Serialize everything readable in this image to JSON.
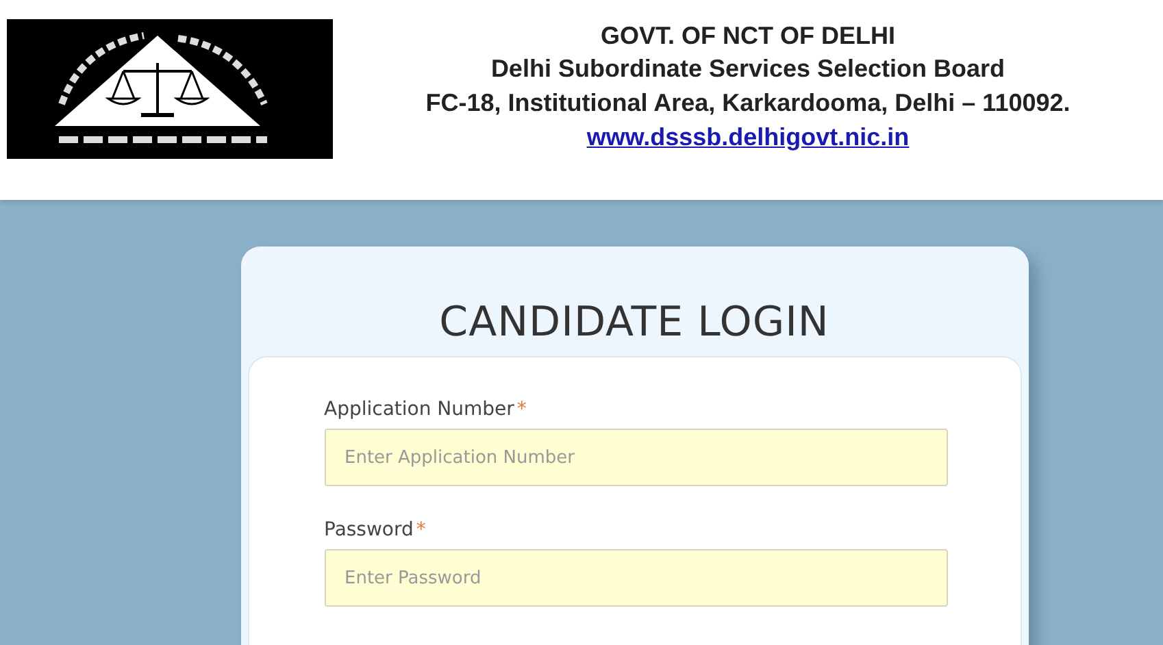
{
  "header": {
    "lines": [
      "GOVT. OF NCT OF DELHI",
      "Delhi Subordinate Services Selection Board",
      "FC-18, Institutional Area, Karkardooma, Delhi – 110092."
    ],
    "link": "www.dsssb.delhigovt.nic.in"
  },
  "login": {
    "title": "CANDIDATE LOGIN",
    "fields": [
      {
        "label": "Application Number",
        "required_mark": "*",
        "placeholder": "Enter Application Number"
      },
      {
        "label": "Password",
        "required_mark": "*",
        "placeholder": "Enter Password"
      }
    ]
  }
}
